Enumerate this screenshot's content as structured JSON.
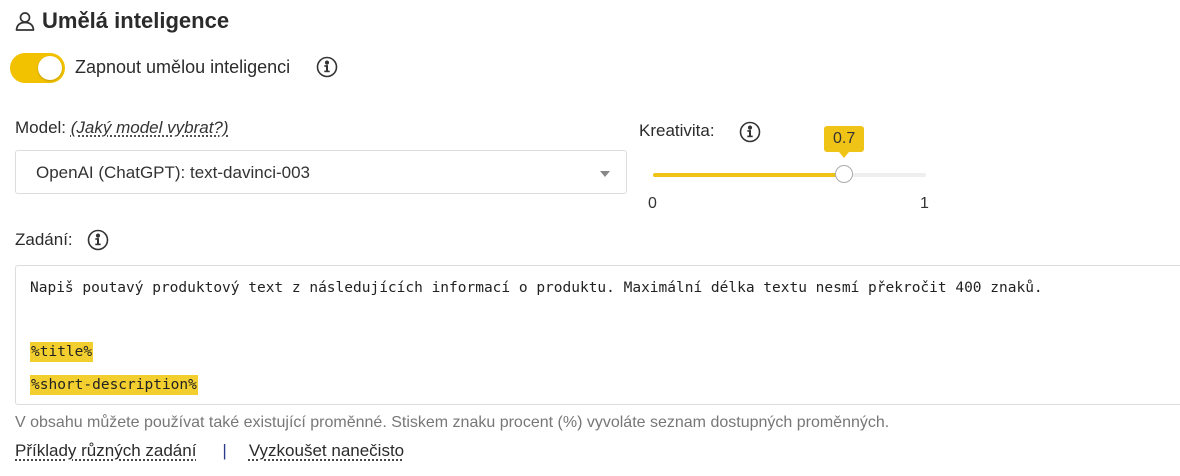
{
  "header": {
    "title": "Umělá inteligence",
    "icon": "user-icon"
  },
  "ai_toggle": {
    "label": "Zapnout umělou inteligenci",
    "on": true,
    "accent": "#f2c200"
  },
  "model": {
    "label": "Model:",
    "help_link": "(Jaký model vybrat?)",
    "selected": "OpenAI (ChatGPT): text-davinci-003"
  },
  "creativity": {
    "label": "Kreativita:",
    "value": 0.7,
    "value_text": "0.7",
    "min": "0",
    "max": "1"
  },
  "prompt": {
    "label": "Zadání:",
    "text": "Napiš poutavý produktový text z následujících informací o produktu. Maximální délka textu nesmí překročit 400 znaků.",
    "variables": [
      "%title%",
      "%short-description%"
    ]
  },
  "hint": "V obsahu můžete používat také existující proměnné. Stiskem znaku procent (%) vyvoláte seznam dostupných proměnných.",
  "footer": {
    "examples_link": "Příklady různých zadání",
    "separator": "|",
    "test_link": "Vyzkoušet nanečisto"
  }
}
